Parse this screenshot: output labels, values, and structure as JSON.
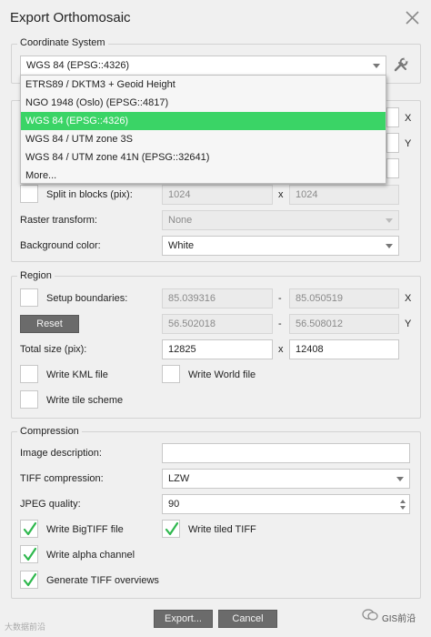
{
  "window": {
    "title": "Export Orthomosaic"
  },
  "coordinate_system": {
    "legend": "Coordinate System",
    "selected": "WGS 84 (EPSG::4326)",
    "options": [
      "ETRS89 / DKTM3 + Geoid Height",
      "NGO 1948 (Oslo) (EPSG::4817)",
      "WGS 84 (EPSG::4326)",
      "WGS 84 / UTM zone 3S",
      "WGS 84 / UTM zone 41N (EPSG::32641)",
      "More..."
    ],
    "highlighted_index": 2
  },
  "raster": {
    "axis_x": "X",
    "axis_y": "Y",
    "split_label": "Split in blocks (pix):",
    "split_w": "1024",
    "split_h": "1024",
    "times": "x",
    "transform_label": "Raster transform:",
    "transform_value": "None",
    "bg_label": "Background color:",
    "bg_value": "White"
  },
  "region": {
    "legend": "Region",
    "setup_label": "Setup boundaries:",
    "x_min": "85.039316",
    "x_max": "85.050519",
    "y_min": "56.502018",
    "y_max": "56.508012",
    "dash": "-",
    "axis_x": "X",
    "axis_y": "Y",
    "reset_label": "Reset",
    "total_label": "Total size (pix):",
    "total_w": "12825",
    "total_h": "12408",
    "times": "x",
    "kml_label": "Write KML file",
    "world_label": "Write World file",
    "tile_label": "Write tile scheme"
  },
  "compression": {
    "legend": "Compression",
    "desc_label": "Image description:",
    "desc_value": "",
    "tiff_label": "TIFF compression:",
    "tiff_value": "LZW",
    "jpeg_label": "JPEG quality:",
    "jpeg_value": "90",
    "bigtiff_label": "Write BigTIFF file",
    "tiled_label": "Write tiled TIFF",
    "alpha_label": "Write alpha channel",
    "overviews_label": "Generate TIFF overviews"
  },
  "footer": {
    "export_label": "Export...",
    "cancel_label": "Cancel"
  },
  "watermarks": {
    "left": "大数据前沿",
    "right": "GIS前沿"
  },
  "colors": {
    "highlight": "#3ad466",
    "check": "#2fb84e",
    "button": "#6b6b6b"
  }
}
